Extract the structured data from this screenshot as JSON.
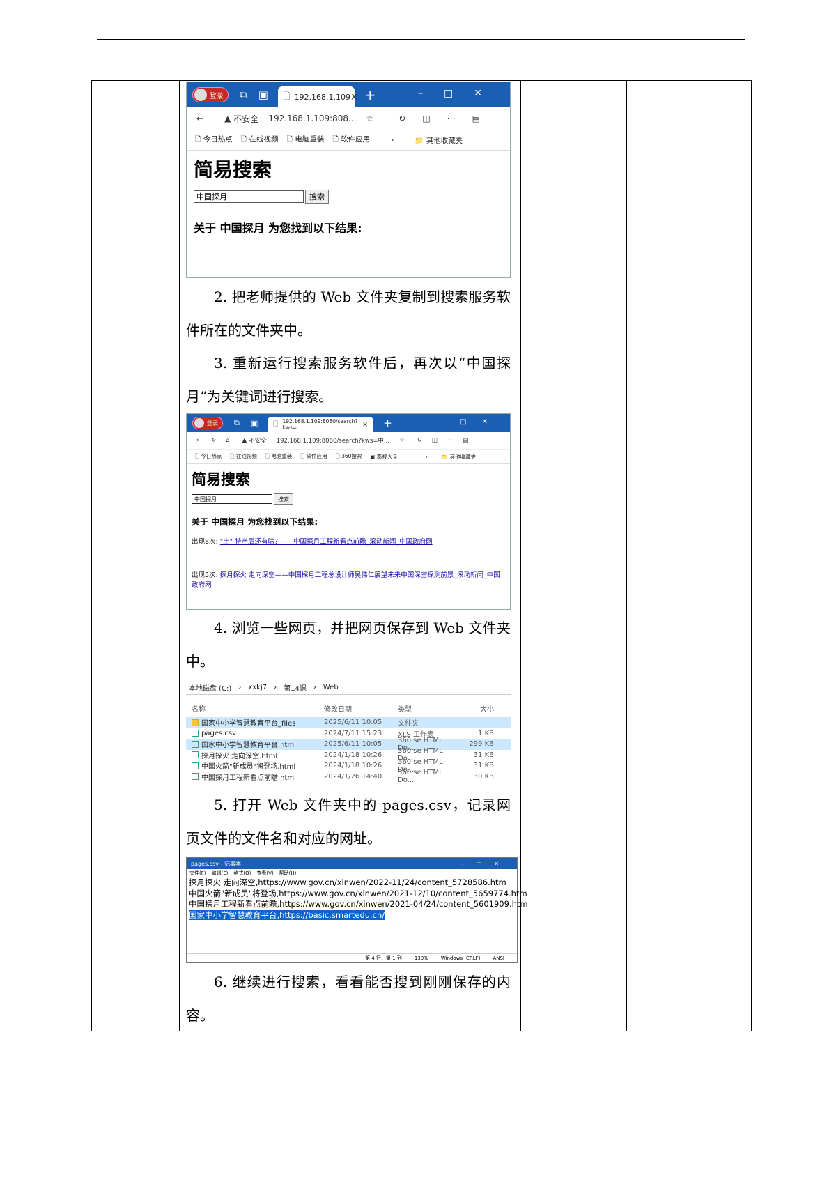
{
  "shot1": {
    "avatar_label": "登录",
    "tab_title": "192.168.1.109",
    "address_warning": "不安全",
    "address_url": "192.168.1.109:808...",
    "favorites": [
      "今日热点",
      "在线视频",
      "电脑重装",
      "软件应用"
    ],
    "other_fav": "其他收藏夹",
    "page_title": "简易搜索",
    "search_value": "中国探月",
    "search_button": "搜索",
    "result_heading": "关于 中国探月 为您找到以下结果:"
  },
  "steps": {
    "s2": "2. 把老师提供的 Web 文件夹复制到搜索服务软件所在的文件夹中。",
    "s3": "3. 重新运行搜索服务软件后，再次以“中国探月”为关键词进行搜索。",
    "s4": "4. 浏览一些网页，并把网页保存到 Web 文件夹中。",
    "s5": "5. 打开 Web 文件夹中的 pages.csv，记录网页文件的文件名和对应的网址。",
    "s6": "6. 继续进行搜索，看看能否搜到刚刚保存的内容。"
  },
  "shot2": {
    "avatar_label": "登录",
    "tab_title": "192.168.1.109:8080/search?kws=...",
    "address_warning": "不安全",
    "address_url": "192.168.1.109:8080/search?kws=中...",
    "favorites": [
      "今日热点",
      "在线视频",
      "电脑重装",
      "软件应用",
      "360搜索",
      "影视大全"
    ],
    "other_fav": "其他收藏夹",
    "page_title": "简易搜索",
    "search_value": "中国探月",
    "search_button": "搜索",
    "result_heading": "关于 中国探月 为您找到以下结果:",
    "result1_prefix": "出现8次:",
    "result1_link": "\"土\" 特产后还有啥? ——中国探月工程新看点前瞻_滚动新闻_中国政府网",
    "result2_prefix": "出现5次:",
    "result2_link": "探月探火 走向深空——中国探月工程总设计师吴伟仁展望未来中国深空探测前景_滚动新闻_中国政府网"
  },
  "explorer": {
    "crumbs": [
      "本地磁盘 (C:)",
      "›",
      "xxkj7",
      "›",
      "第14课",
      "›",
      "Web"
    ],
    "headers": [
      "名称",
      "修改日期",
      "类型",
      "大小"
    ],
    "rows": [
      {
        "name": "国家中小学智慧教育平台_files",
        "date": "2025/6/11 10:05",
        "type": "文件夹",
        "size": ""
      },
      {
        "name": "pages.csv",
        "date": "2024/7/11 15:23",
        "type": "XLS 工作表",
        "size": "1 KB"
      },
      {
        "name": "国家中小学智慧教育平台.html",
        "date": "2025/6/11 10:05",
        "type": "360 se HTML Do...",
        "size": "299 KB"
      },
      {
        "name": "探月探火 走向深空.html",
        "date": "2024/1/18 10:26",
        "type": "360 se HTML Do...",
        "size": "31 KB"
      },
      {
        "name": "中国火箭\"新成员\"将登场.html",
        "date": "2024/1/18 10:26",
        "type": "360 se HTML Do...",
        "size": "31 KB"
      },
      {
        "name": "中国探月工程新看点前瞻.html",
        "date": "2024/1/26 14:40",
        "type": "360 se HTML Do...",
        "size": "30 KB"
      }
    ]
  },
  "notepad": {
    "title": "pages.csv - 记事本",
    "menu": [
      "文件(F)",
      "编辑(E)",
      "格式(O)",
      "查看(V)",
      "帮助(H)"
    ],
    "lines": [
      "探月探火 走向深空,https://www.gov.cn/xinwen/2022-11/24/content_5728586.htm",
      "中国火箭\"新成员\"将登场,https://www.gov.cn/xinwen/2021-12/10/content_5659774.htm",
      "中国探月工程新看点前瞻,https://www.gov.cn/xinwen/2021-04/24/content_5601909.htm",
      "国家中小学智慧教育平台,https://basic.smartedu.cn/"
    ],
    "status": [
      "第 4 行，第 1 列",
      "130%",
      "Windows (CRLF)",
      "ANSI"
    ]
  }
}
